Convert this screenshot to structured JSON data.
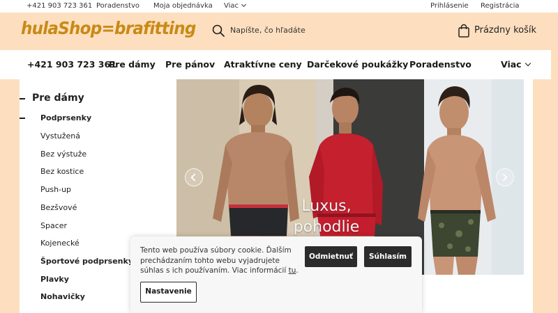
{
  "topbar": {
    "phone": "+421 903 723 361",
    "advice": "Poradenstvo",
    "my_order": "Moja objednávka",
    "more": "Viac",
    "login": "Prihlásenie",
    "register": "Registrácia"
  },
  "header": {
    "logo": "hulaShop=brafitting",
    "search_placeholder": "Napíšte, čo hľadáte",
    "cart_label": "Prázdny košík"
  },
  "nav": {
    "items": [
      {
        "label": "+421 903 723 361"
      },
      {
        "label": "Pre dámy"
      },
      {
        "label": "Pre pánov"
      },
      {
        "label": "Atraktívne ceny"
      },
      {
        "label": "Darčekové poukážky"
      },
      {
        "label": "Poradenstvo"
      }
    ],
    "more": "Viac"
  },
  "sidebar": {
    "title": "Pre dámy",
    "items": [
      {
        "label": "Podprsenky"
      },
      {
        "label": "Vystužená"
      },
      {
        "label": "Bez výstuže"
      },
      {
        "label": "Bez kostice"
      },
      {
        "label": "Push-up"
      },
      {
        "label": "Bezšvové"
      },
      {
        "label": "Spacer"
      },
      {
        "label": "Kojenecké"
      },
      {
        "label": "Športové podprsenky"
      },
      {
        "label": "Plavky"
      },
      {
        "label": "Nohavičky"
      }
    ]
  },
  "hero": {
    "line1": "Luxus,",
    "line2": "pohodlie"
  },
  "cookie": {
    "text": "Tento web používa súbory cookie. Ďalším prechádzaním tohto webu vyjadrujete súhlas s ich používaním. Viac informácií",
    "link": "tu",
    "period": ".",
    "reject": "Odmietnuť",
    "accept": "Súhlasím",
    "settings": "Nastavenie"
  },
  "colors": {
    "header_bg": "#fddfbf",
    "logo": "#c88a16",
    "button_dark": "#2b2b2b"
  }
}
